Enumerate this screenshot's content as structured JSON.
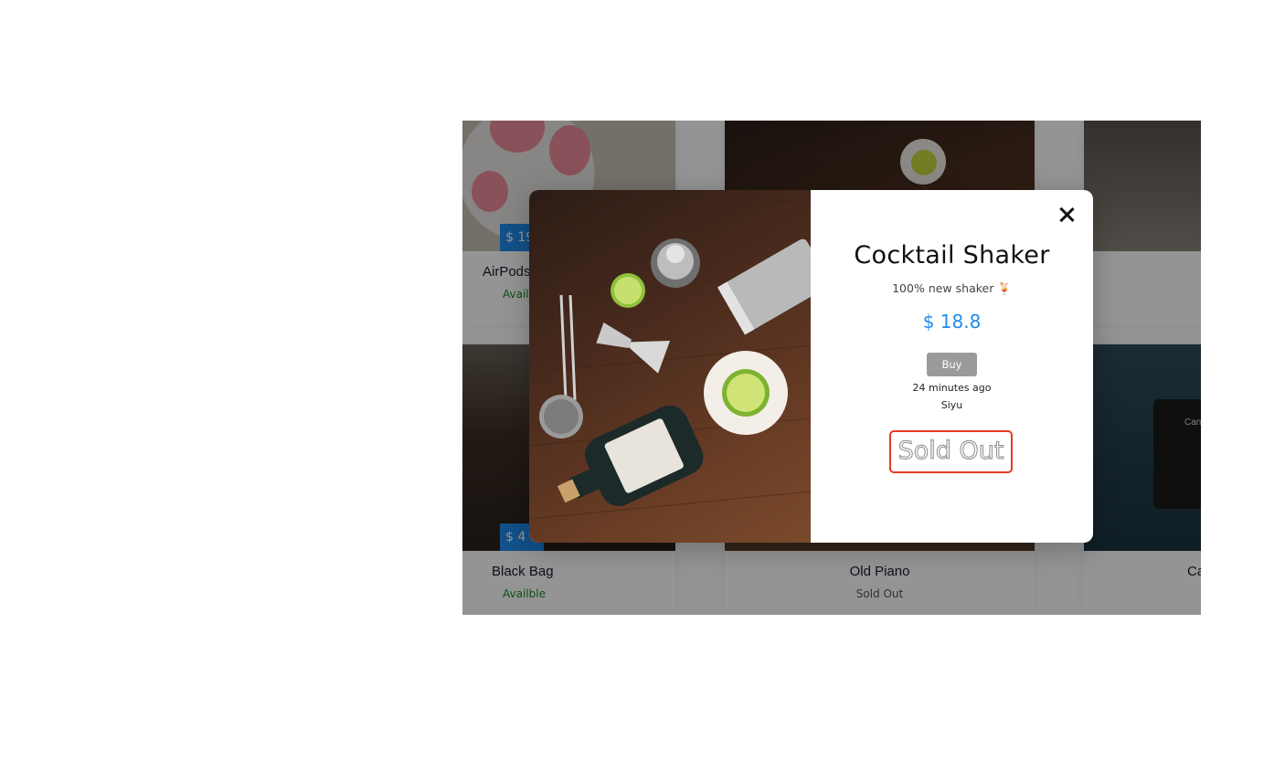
{
  "grid": {
    "cards": [
      {
        "name": "AirPods",
        "price": "$ 19",
        "status": "Availble",
        "image": "paw-print-airpods-case"
      },
      {
        "name": "",
        "price": "",
        "status": "",
        "image": "bar-tools"
      },
      {
        "name": "",
        "price": "",
        "status": "",
        "image": "pot"
      },
      {
        "name": "Black Bag",
        "price": "$ 4",
        "status": "Availble",
        "image": "black-bag"
      },
      {
        "name": "Old Piano",
        "price": "",
        "status": "Sold Out",
        "image": "old-piano"
      },
      {
        "name": "Ca",
        "price": "",
        "status": "",
        "image": "canon-camera"
      }
    ]
  },
  "modal": {
    "title": "Cocktail Shaker",
    "subtitle": "100% new shaker 🍹",
    "price": "$ 18.8",
    "buy_label": "Buy",
    "time": "24 minutes ago",
    "seller": "Siyu",
    "sold_out": "Sold Out",
    "close_icon": "close-icon",
    "photo": "cocktail-shaker-bottle-lime"
  },
  "colors": {
    "accent": "#1f8cec",
    "available": "#1a8a2a",
    "sold_border": "#e63a23",
    "buy_disabled": "#9a9a9a"
  }
}
